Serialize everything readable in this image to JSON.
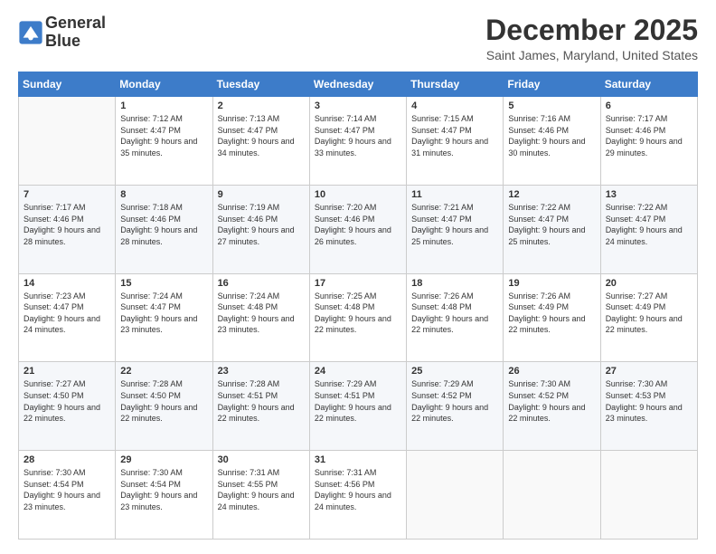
{
  "header": {
    "logo_line1": "General",
    "logo_line2": "Blue",
    "month": "December 2025",
    "location": "Saint James, Maryland, United States"
  },
  "weekdays": [
    "Sunday",
    "Monday",
    "Tuesday",
    "Wednesday",
    "Thursday",
    "Friday",
    "Saturday"
  ],
  "weeks": [
    [
      {
        "day": "",
        "sunrise": "",
        "sunset": "",
        "daylight": ""
      },
      {
        "day": "1",
        "sunrise": "Sunrise: 7:12 AM",
        "sunset": "Sunset: 4:47 PM",
        "daylight": "Daylight: 9 hours and 35 minutes."
      },
      {
        "day": "2",
        "sunrise": "Sunrise: 7:13 AM",
        "sunset": "Sunset: 4:47 PM",
        "daylight": "Daylight: 9 hours and 34 minutes."
      },
      {
        "day": "3",
        "sunrise": "Sunrise: 7:14 AM",
        "sunset": "Sunset: 4:47 PM",
        "daylight": "Daylight: 9 hours and 33 minutes."
      },
      {
        "day": "4",
        "sunrise": "Sunrise: 7:15 AM",
        "sunset": "Sunset: 4:47 PM",
        "daylight": "Daylight: 9 hours and 31 minutes."
      },
      {
        "day": "5",
        "sunrise": "Sunrise: 7:16 AM",
        "sunset": "Sunset: 4:46 PM",
        "daylight": "Daylight: 9 hours and 30 minutes."
      },
      {
        "day": "6",
        "sunrise": "Sunrise: 7:17 AM",
        "sunset": "Sunset: 4:46 PM",
        "daylight": "Daylight: 9 hours and 29 minutes."
      }
    ],
    [
      {
        "day": "7",
        "sunrise": "Sunrise: 7:17 AM",
        "sunset": "Sunset: 4:46 PM",
        "daylight": "Daylight: 9 hours and 28 minutes."
      },
      {
        "day": "8",
        "sunrise": "Sunrise: 7:18 AM",
        "sunset": "Sunset: 4:46 PM",
        "daylight": "Daylight: 9 hours and 28 minutes."
      },
      {
        "day": "9",
        "sunrise": "Sunrise: 7:19 AM",
        "sunset": "Sunset: 4:46 PM",
        "daylight": "Daylight: 9 hours and 27 minutes."
      },
      {
        "day": "10",
        "sunrise": "Sunrise: 7:20 AM",
        "sunset": "Sunset: 4:46 PM",
        "daylight": "Daylight: 9 hours and 26 minutes."
      },
      {
        "day": "11",
        "sunrise": "Sunrise: 7:21 AM",
        "sunset": "Sunset: 4:47 PM",
        "daylight": "Daylight: 9 hours and 25 minutes."
      },
      {
        "day": "12",
        "sunrise": "Sunrise: 7:22 AM",
        "sunset": "Sunset: 4:47 PM",
        "daylight": "Daylight: 9 hours and 25 minutes."
      },
      {
        "day": "13",
        "sunrise": "Sunrise: 7:22 AM",
        "sunset": "Sunset: 4:47 PM",
        "daylight": "Daylight: 9 hours and 24 minutes."
      }
    ],
    [
      {
        "day": "14",
        "sunrise": "Sunrise: 7:23 AM",
        "sunset": "Sunset: 4:47 PM",
        "daylight": "Daylight: 9 hours and 24 minutes."
      },
      {
        "day": "15",
        "sunrise": "Sunrise: 7:24 AM",
        "sunset": "Sunset: 4:47 PM",
        "daylight": "Daylight: 9 hours and 23 minutes."
      },
      {
        "day": "16",
        "sunrise": "Sunrise: 7:24 AM",
        "sunset": "Sunset: 4:48 PM",
        "daylight": "Daylight: 9 hours and 23 minutes."
      },
      {
        "day": "17",
        "sunrise": "Sunrise: 7:25 AM",
        "sunset": "Sunset: 4:48 PM",
        "daylight": "Daylight: 9 hours and 22 minutes."
      },
      {
        "day": "18",
        "sunrise": "Sunrise: 7:26 AM",
        "sunset": "Sunset: 4:48 PM",
        "daylight": "Daylight: 9 hours and 22 minutes."
      },
      {
        "day": "19",
        "sunrise": "Sunrise: 7:26 AM",
        "sunset": "Sunset: 4:49 PM",
        "daylight": "Daylight: 9 hours and 22 minutes."
      },
      {
        "day": "20",
        "sunrise": "Sunrise: 7:27 AM",
        "sunset": "Sunset: 4:49 PM",
        "daylight": "Daylight: 9 hours and 22 minutes."
      }
    ],
    [
      {
        "day": "21",
        "sunrise": "Sunrise: 7:27 AM",
        "sunset": "Sunset: 4:50 PM",
        "daylight": "Daylight: 9 hours and 22 minutes."
      },
      {
        "day": "22",
        "sunrise": "Sunrise: 7:28 AM",
        "sunset": "Sunset: 4:50 PM",
        "daylight": "Daylight: 9 hours and 22 minutes."
      },
      {
        "day": "23",
        "sunrise": "Sunrise: 7:28 AM",
        "sunset": "Sunset: 4:51 PM",
        "daylight": "Daylight: 9 hours and 22 minutes."
      },
      {
        "day": "24",
        "sunrise": "Sunrise: 7:29 AM",
        "sunset": "Sunset: 4:51 PM",
        "daylight": "Daylight: 9 hours and 22 minutes."
      },
      {
        "day": "25",
        "sunrise": "Sunrise: 7:29 AM",
        "sunset": "Sunset: 4:52 PM",
        "daylight": "Daylight: 9 hours and 22 minutes."
      },
      {
        "day": "26",
        "sunrise": "Sunrise: 7:30 AM",
        "sunset": "Sunset: 4:52 PM",
        "daylight": "Daylight: 9 hours and 22 minutes."
      },
      {
        "day": "27",
        "sunrise": "Sunrise: 7:30 AM",
        "sunset": "Sunset: 4:53 PM",
        "daylight": "Daylight: 9 hours and 23 minutes."
      }
    ],
    [
      {
        "day": "28",
        "sunrise": "Sunrise: 7:30 AM",
        "sunset": "Sunset: 4:54 PM",
        "daylight": "Daylight: 9 hours and 23 minutes."
      },
      {
        "day": "29",
        "sunrise": "Sunrise: 7:30 AM",
        "sunset": "Sunset: 4:54 PM",
        "daylight": "Daylight: 9 hours and 23 minutes."
      },
      {
        "day": "30",
        "sunrise": "Sunrise: 7:31 AM",
        "sunset": "Sunset: 4:55 PM",
        "daylight": "Daylight: 9 hours and 24 minutes."
      },
      {
        "day": "31",
        "sunrise": "Sunrise: 7:31 AM",
        "sunset": "Sunset: 4:56 PM",
        "daylight": "Daylight: 9 hours and 24 minutes."
      },
      {
        "day": "",
        "sunrise": "",
        "sunset": "",
        "daylight": ""
      },
      {
        "day": "",
        "sunrise": "",
        "sunset": "",
        "daylight": ""
      },
      {
        "day": "",
        "sunrise": "",
        "sunset": "",
        "daylight": ""
      }
    ]
  ]
}
